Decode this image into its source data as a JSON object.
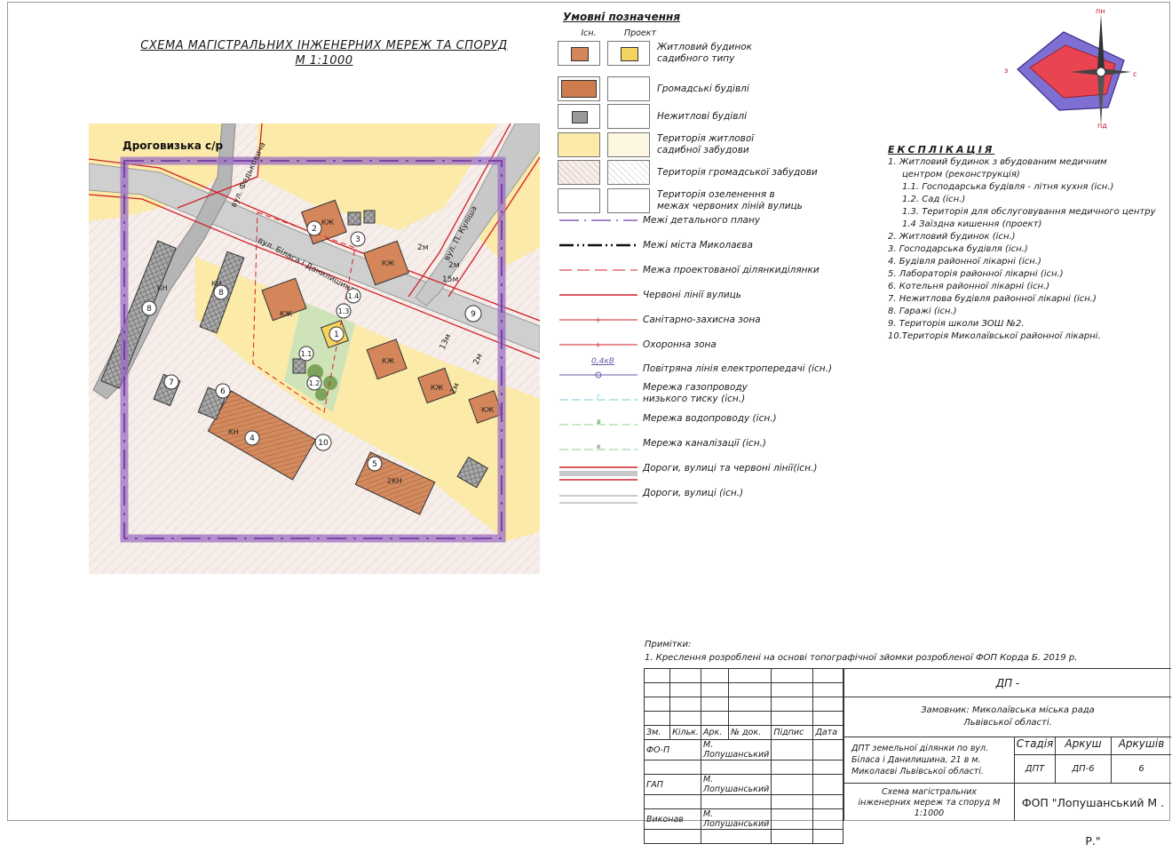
{
  "title": {
    "line1": "СХЕМА МАГІСТРАЛЬНИХ ІНЖЕНЕРНИХ МЕРЕЖ ТА СПОРУД",
    "line2": "М 1:1000"
  },
  "map": {
    "region_label": "Дроговизька с/р",
    "streets": [
      "вул. Федьковича",
      "вул. Біласа і Данилишина",
      "вул. П. Куліша"
    ],
    "building_codes": {
      "kzh": "КЖ",
      "kn": "КН",
      "kn2": "2КН"
    },
    "dims": [
      "2м",
      "2м",
      "15м",
      "13м",
      "2м",
      "2м"
    ],
    "numbers": [
      "1",
      "1.1",
      "1.2",
      "1.3",
      "1.4",
      "2",
      "3",
      "4",
      "5",
      "6",
      "7",
      "8",
      "9",
      "10"
    ]
  },
  "compass": {
    "north": "пн",
    "south": "пд",
    "west": "з",
    "east": "с"
  },
  "legend": {
    "heading": "Умовні позначення",
    "col_existing": "Існ.",
    "col_project": "Проект",
    "rows": [
      {
        "label": "Житловий будинок садибного типу"
      },
      {
        "label": "Громадські будівлі"
      },
      {
        "label": "Нежитлові будівлі"
      },
      {
        "label": "Територія житлової садибної забудови"
      },
      {
        "label": "Територія громадської забудови"
      },
      {
        "label": "Територія озеленення в межах червоних ліній вулиць"
      },
      {
        "label": "Межі детального плану"
      },
      {
        "label": "Межі міста Миколаєва"
      },
      {
        "label": "Межа проектованої ділянкиділянки"
      },
      {
        "label": "Червоні лінії вулиць"
      },
      {
        "label": "Санітарно-захисна зона"
      },
      {
        "label": "Охоронна зона"
      },
      {
        "label": "Повітряна лінія електропередачі (існ.)",
        "marker": "0,4кВ"
      },
      {
        "label": "Мережа газопроводу низького тиску (існ.)",
        "marker": "г"
      },
      {
        "label": "Мережа водопроводу (існ.)",
        "marker": "в"
      },
      {
        "label": "Мережа каналізації (існ.)",
        "marker": "к"
      },
      {
        "label": "Дороги, вулиці та червоні лінії(існ.)"
      },
      {
        "label": "Дороги, вулиці (існ.)"
      }
    ],
    "colors": {
      "residential": "#fbeaa8",
      "public": "#f3e6e0",
      "building": "#cf7d4f",
      "purple": "#8e5bb8",
      "red": "#d0202a"
    }
  },
  "explication": {
    "heading": "ЕКСПЛІКАЦІЯ",
    "items": [
      "1. Житловий будинок з вбудованим медичним",
      "центром (реконструкція)",
      "1.1. Господарська будівля - літня кухня (існ.)",
      "1.2. Сад (існ.)",
      "1.3. Територія для обслуговування медичного центру",
      "1.4 Заїздна кишення (проект)",
      "2. Житловий будинок (існ.)",
      "3. Господарська будівля (існ.)",
      "4. Будівля районної лікарні (існ.)",
      "5. Лабораторія районної лікарні (існ.)",
      "6. Котельня районної лікарні (існ.)",
      "7. Нежитлова будівля районної лікарні (існ.)",
      "8. Гаражі (існ.)",
      "9. Територія школи ЗОШ №2.",
      "10.Територія Миколаївської районної лікарні."
    ]
  },
  "notes": {
    "heading": "Примітки:",
    "line1": "1. Креслення розроблені на основі топографічної зйомки розробленої ФОП Корда Б. 2019 р."
  },
  "stamp": {
    "code": "ДП -",
    "customer": "Замовник: Миколаївська міська рада",
    "customer2": "Львівської області.",
    "headers": [
      "Зм.",
      "Кільк.",
      "Арк.",
      "№ док.",
      "Підпис",
      "Дата"
    ],
    "people": [
      {
        "role": "ФО-П",
        "name": "М. Лопушанський"
      },
      {
        "role": "ГАП",
        "name": "М. Лопушанський"
      },
      {
        "role": "Виконав",
        "name": "М. Лопушанський"
      }
    ],
    "project": "ДПТ земельної ділянки по вул. Біласа і Данилишина, 21 в м. Миколаєві Львівської області.",
    "sheet_name": "Схема магістральних інженерних мереж та споруд М 1:1000",
    "stage_h": "Стадія",
    "sheet_h": "Аркуш",
    "sheets_h": "Аркушів",
    "stage": "ДПТ",
    "sheet": "ДП-6",
    "sheets": "6",
    "firm": "ФОП \"Лопушанський М . Р.\""
  }
}
